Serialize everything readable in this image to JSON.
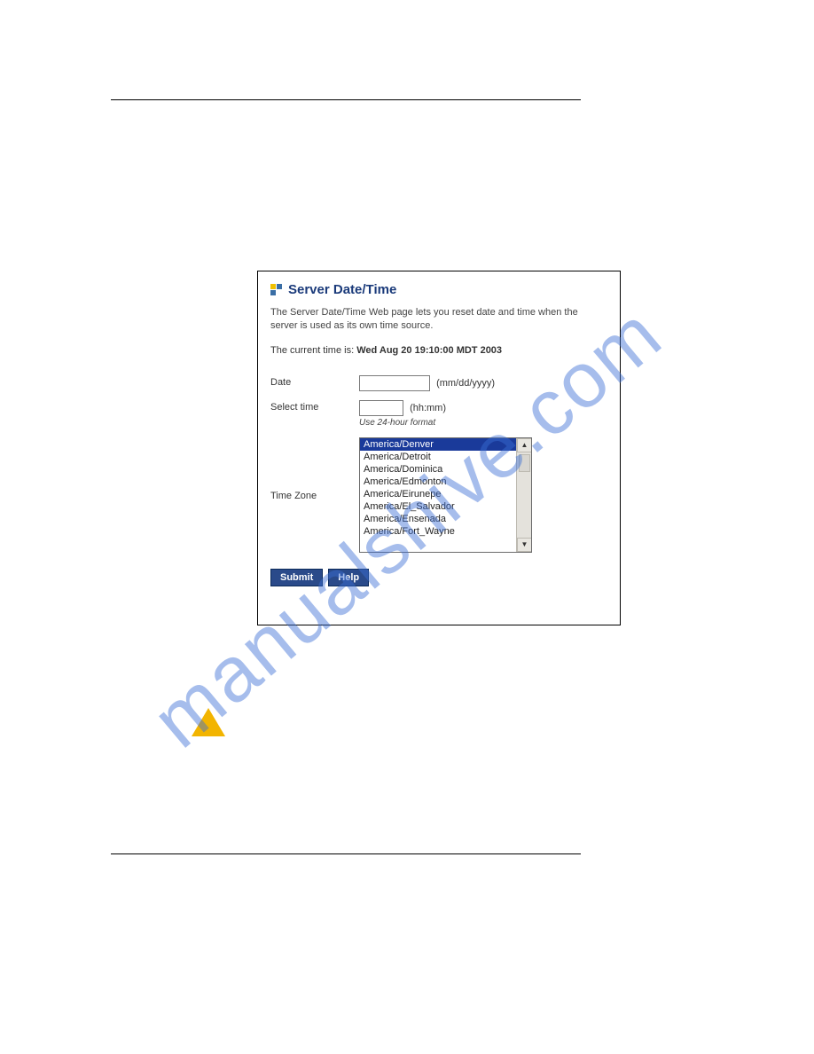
{
  "watermark": "manualshive.com",
  "dialog": {
    "title": "Server Date/Time",
    "description": "The Server Date/Time Web page lets you reset date and time when the server is used as its own time source.",
    "current_time_label": "The current time is:",
    "current_time_value": "Wed Aug 20 19:10:00 MDT 2003",
    "date": {
      "label": "Date",
      "hint": "(mm/dd/yyyy)",
      "value": ""
    },
    "time": {
      "label": "Select time",
      "hint_inline": "(hh:mm)",
      "hint_below": "Use 24-hour format",
      "value": ""
    },
    "timezone": {
      "label": "Time Zone",
      "selected": "America/Denver",
      "options": [
        "America/Denver",
        "America/Detroit",
        "America/Dominica",
        "America/Edmonton",
        "America/Eirunepe",
        "America/El_Salvador",
        "America/Ensenada",
        "America/Fort_Wayne"
      ]
    },
    "buttons": {
      "submit": "Submit",
      "help": "Help"
    }
  },
  "glyphs": {
    "up": "▲",
    "down": "▼"
  }
}
